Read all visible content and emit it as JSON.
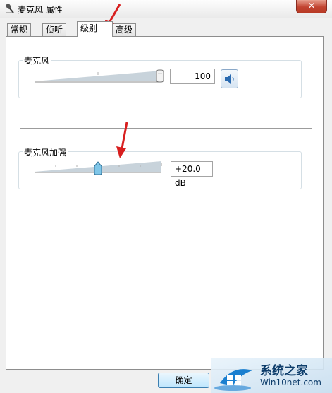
{
  "window": {
    "title": "麦克风 属性",
    "close_glyph": "✕"
  },
  "tabs": [
    {
      "label": "常规",
      "active": false
    },
    {
      "label": "侦听",
      "active": false
    },
    {
      "label": "级别",
      "active": true
    },
    {
      "label": "高级",
      "active": false
    }
  ],
  "microphone": {
    "label": "麦克风",
    "level": 100,
    "level_max": 100,
    "value_text": "100",
    "speaker_icon": "speaker-icon"
  },
  "boost": {
    "label": "麦克风加强",
    "value_db": 20.0,
    "max_db": 30.0,
    "value_text": "+20.0 dB"
  },
  "buttons": {
    "ok_label": "确定"
  },
  "watermark": {
    "text": "系统之家",
    "url": "Win10net.com",
    "logo_icon": "windows-logo-icon"
  },
  "colors": {
    "close_red": "#c24431",
    "slider_track": "#c8d3db",
    "boost_thumb": "#7fc6e8",
    "annotation_arrow": "#d81e1e"
  }
}
